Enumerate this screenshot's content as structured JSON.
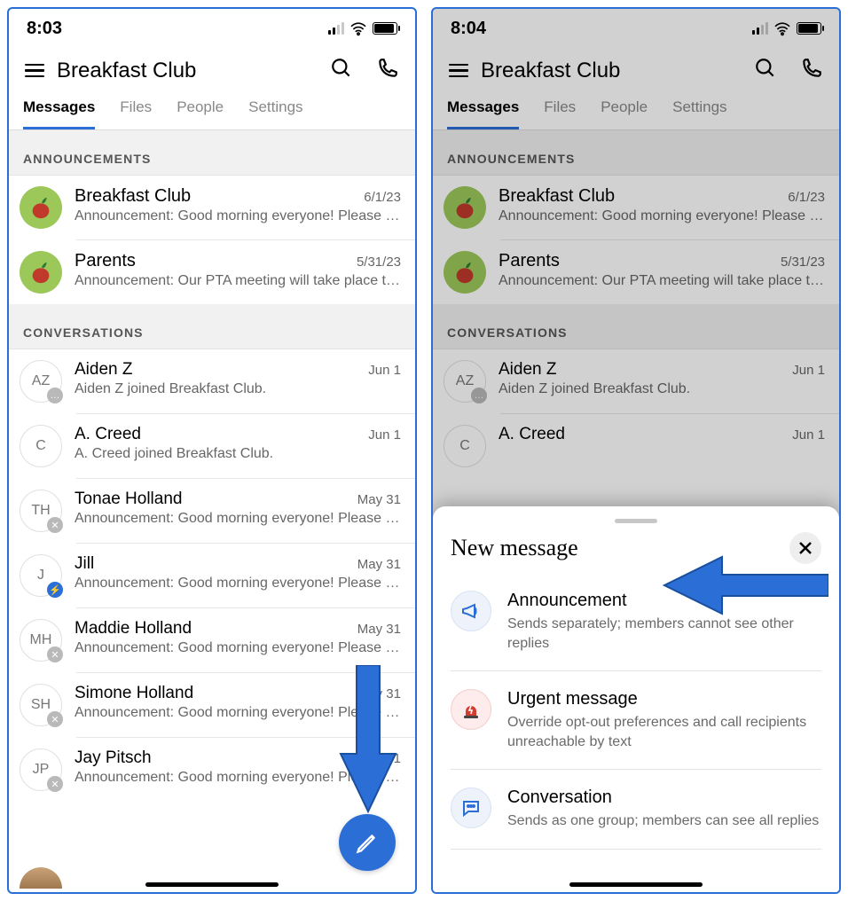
{
  "left": {
    "time": "8:03",
    "title": "Breakfast Club",
    "tabs": [
      "Messages",
      "Files",
      "People",
      "Settings"
    ],
    "active_tab": 0,
    "sections": {
      "announcements": {
        "label": "ANNOUNCEMENTS",
        "rows": [
          {
            "name": "Breakfast Club",
            "date": "6/1/23",
            "snippet": "Announcement: Good morning everyone! Please fill…",
            "avatar": "apple"
          },
          {
            "name": "Parents",
            "date": "5/31/23",
            "snippet": "Announcement: Our PTA meeting will take place to…",
            "avatar": "apple"
          }
        ]
      },
      "conversations": {
        "label": "CONVERSATIONS",
        "rows": [
          {
            "initials": "AZ",
            "name": "Aiden Z",
            "date": "Jun 1",
            "snippet": "Aiden Z joined Breakfast Club.",
            "badge": "gray"
          },
          {
            "initials": "C",
            "name": "A. Creed",
            "date": "Jun 1",
            "snippet": "A. Creed joined Breakfast Club."
          },
          {
            "initials": "TH",
            "name": "Tonae Holland",
            "date": "May 31",
            "snippet": "Announcement: Good morning everyone! Please fill…",
            "badge": "x"
          },
          {
            "initials": "J",
            "name": "Jill",
            "date": "May 31",
            "snippet": "Announcement: Good morning everyone! Please fill…",
            "badge": "bolt"
          },
          {
            "initials": "MH",
            "name": "Maddie Holland",
            "date": "May 31",
            "snippet": "Announcement: Good morning everyone! Please fill…",
            "badge": "x"
          },
          {
            "initials": "SH",
            "name": "Simone Holland",
            "date": "May 31",
            "snippet": "Announcement: Good morning everyone! Please fill…",
            "badge": "x"
          },
          {
            "initials": "JP",
            "name": "Jay Pitsch",
            "date": "May 31",
            "snippet": "Announcement: Good morning everyone! Please fill…",
            "badge": "x"
          }
        ]
      }
    }
  },
  "right": {
    "time": "8:04",
    "title": "Breakfast Club",
    "tabs": [
      "Messages",
      "Files",
      "People",
      "Settings"
    ],
    "active_tab": 0,
    "sections": {
      "announcements": {
        "label": "ANNOUNCEMENTS",
        "rows": [
          {
            "name": "Breakfast Club",
            "date": "6/1/23",
            "snippet": "Announcement: Good morning everyone! Please fill…",
            "avatar": "apple"
          },
          {
            "name": "Parents",
            "date": "5/31/23",
            "snippet": "Announcement: Our PTA meeting will take place to…",
            "avatar": "apple"
          }
        ]
      },
      "conversations": {
        "label": "CONVERSATIONS",
        "rows": [
          {
            "initials": "AZ",
            "name": "Aiden Z",
            "date": "Jun 1",
            "snippet": "Aiden Z joined Breakfast Club.",
            "badge": "gray"
          },
          {
            "initials": "C",
            "name": "A. Creed",
            "date": "Jun 1",
            "snippet": ""
          }
        ]
      }
    },
    "sheet": {
      "title": "New message",
      "options": [
        {
          "title": "Announcement",
          "desc": "Sends separately; members cannot see other replies",
          "icon": "megaphone"
        },
        {
          "title": "Urgent message",
          "desc": "Override opt-out preferences and call recipients unreachable by text",
          "icon": "urgent"
        },
        {
          "title": "Conversation",
          "desc": "Sends as one group; members can see all replies",
          "icon": "chat"
        }
      ]
    }
  },
  "icons": {
    "dots": "…",
    "x": "✕",
    "bolt": "⚡"
  }
}
